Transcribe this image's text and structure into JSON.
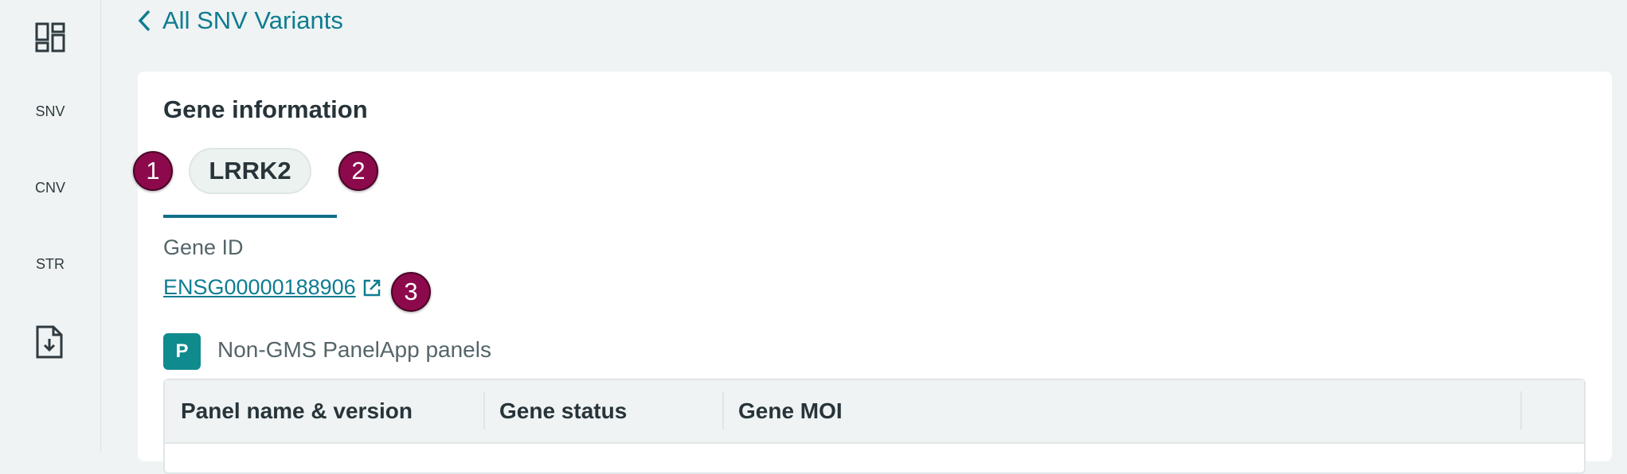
{
  "sidebar": {
    "items": [
      {
        "icon": "dashboard-icon"
      },
      {
        "label": "SNV"
      },
      {
        "label": "CNV"
      },
      {
        "label": "STR"
      },
      {
        "icon": "file-download-icon"
      }
    ]
  },
  "back_link": {
    "label": "All SNV Variants",
    "icon": "chevron-left-icon"
  },
  "card": {
    "title": "Gene information",
    "tabs": [
      {
        "label": "LRRK2"
      }
    ],
    "gene_id_label": "Gene ID",
    "gene_id_value": "ENSG00000188906",
    "panelapp": {
      "badge": "P",
      "label": "Non-GMS PanelApp panels"
    },
    "table": {
      "columns": [
        "Panel name & version",
        "Gene status",
        "Gene MOI"
      ]
    }
  },
  "markers": [
    "1",
    "2",
    "3"
  ],
  "colors": {
    "accent": "#0f7c91",
    "marker": "#8c0a4b",
    "panelapp": "#0f8a8d"
  }
}
